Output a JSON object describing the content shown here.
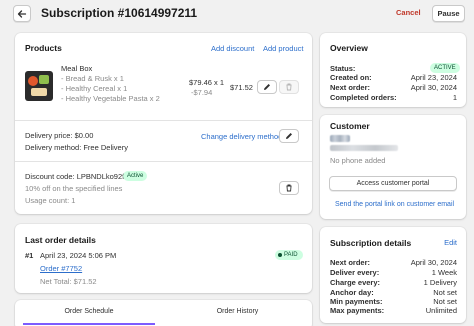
{
  "header": {
    "title": "Subscription #10614997211",
    "cancel_label": "Cancel",
    "pause_label": "Pause"
  },
  "products": {
    "title": "Products",
    "add_discount_label": "Add discount",
    "add_product_label": "Add product",
    "item": {
      "name": "Meal Box",
      "lines": [
        "- Bread & Rusk x 1",
        "- Healthy Cereal x 1",
        "- Healthy Vegetable Pasta x 2"
      ],
      "price_line": "$79.46 x 1",
      "discount_line": "-$7.94",
      "total": "$71.52"
    },
    "delivery_price": "Delivery price: $0.00",
    "delivery_method": "Delivery method: Free Delivery",
    "change_delivery_label": "Change delivery method",
    "discount_code": "Discount code: LPBNDLko92f",
    "discount_status": "Active",
    "discount_desc": "10% off on the specified lines",
    "usage_count": "Usage count: 1"
  },
  "last_order": {
    "title": "Last order details",
    "number": "#1",
    "date": "April 23, 2024 5:06 PM",
    "status": "PAID",
    "order_link": "Order #7752",
    "net_total": "Net Total: $71.52"
  },
  "tabs": [
    {
      "label": "Order Schedule"
    },
    {
      "label": "Order History"
    }
  ],
  "overview": {
    "title": "Overview",
    "rows": [
      {
        "label": "Status:",
        "value": "ACTIVE"
      },
      {
        "label": "Created on:",
        "value": "April 23, 2024"
      },
      {
        "label": "Next order:",
        "value": "April 30, 2024"
      },
      {
        "label": "Completed orders:",
        "value": "1"
      }
    ]
  },
  "customer": {
    "title": "Customer",
    "phone": "No phone added",
    "portal_button": "Access customer portal",
    "send_link": "Send the portal link on customer email"
  },
  "subscription_details": {
    "title": "Subscription details",
    "edit_label": "Edit",
    "rows": [
      {
        "label": "Next order:",
        "value": "April 30, 2024"
      },
      {
        "label": "Deliver every:",
        "value": "1 Week"
      },
      {
        "label": "Charge every:",
        "value": "1 Delivery"
      },
      {
        "label": "Anchor day:",
        "value": "Not set"
      },
      {
        "label": "Min payments:",
        "value": "Not set"
      },
      {
        "label": "Max payments:",
        "value": "Unlimited"
      }
    ]
  },
  "colors": {
    "accent": "#2c6ecb",
    "danger": "#c0392b",
    "success_bg": "#cdfee1",
    "tab_active": "#7c5cff"
  }
}
